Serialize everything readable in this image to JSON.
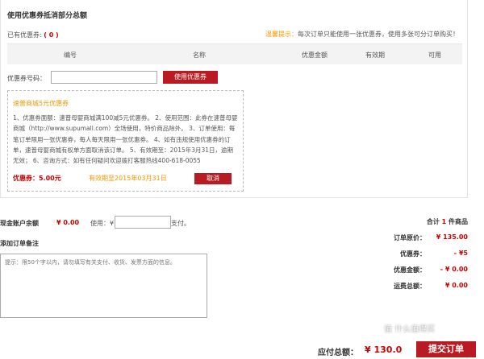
{
  "coupon_section": {
    "title": "使用优惠券抵消部分总额",
    "owned_prefix": "已有优惠券:",
    "owned_count": "( 0 )",
    "tip_label": "温馨提示：",
    "tip_text": "每次订单只能使用一张优惠券，使用多张可分订单购买！",
    "columns": [
      "编号",
      "名称",
      "优惠金额",
      "有效期",
      "可用"
    ],
    "code_label": "优惠券号码：",
    "code_value": "",
    "use_button": "使用优惠券",
    "coupon": {
      "name": "速普商城5元优惠券",
      "description": "1、优惠券面额：速普母婴商城满100减5元优惠券。 2、使用范围：此券在速普母婴商城（http://www.supumall.com）全场使用，特价商品除外。 3、订单使用：每笔订单限用一张优惠券，每人每天限用一张优惠券。 4、如有违规使用优惠券的订单，速普母婴商城有权单方面取消该订单。 5、有效期至：2015年3月31日，逾期无效； 6、咨询方式：如有任何疑问欢迎拨打客服热线400-618-0055",
      "value": "优惠券：5.00元",
      "expiry": "有效期至2015年03月31日",
      "cancel_button": "取消"
    }
  },
  "balance": {
    "title": "现金账户余额",
    "amount": "¥ 0.00",
    "use_label": "使用：¥",
    "pay_label": "支付。"
  },
  "remark": {
    "title": "添加订单备注",
    "placeholder": "提示：限50个字以内，请勿填写有关支付、收货、发票方面的信息。"
  },
  "summary": {
    "count_prefix": "合计",
    "count": "1",
    "count_suffix": "件商品",
    "rows": [
      {
        "label": "订单原价：",
        "value": "¥ 135.00"
      },
      {
        "label": "优惠券：",
        "value": "- ¥5"
      },
      {
        "label": "优惠金额：",
        "value": "- ¥ 0.00"
      },
      {
        "label": "运费总额：",
        "value": "¥ 0.00"
      }
    ]
  },
  "footer": {
    "total_label": "应付总额：",
    "total_value": "¥ 130.0",
    "submit_button": "提交订单",
    "watermark": "值 什么值得买"
  },
  "colors": {
    "accent_red": "#b81c22",
    "price_red": "#cc0000",
    "tip_orange": "#f39800"
  }
}
